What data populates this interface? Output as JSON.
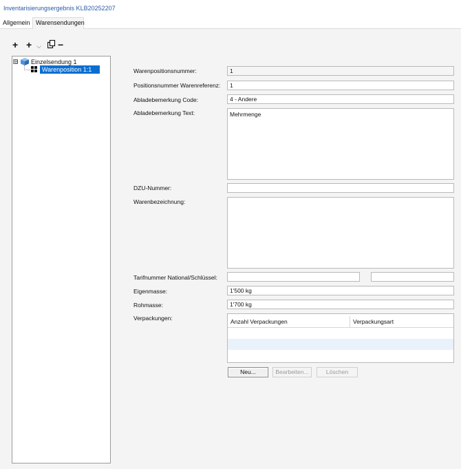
{
  "window": {
    "title": "Inventarisierungsergebnis  KLB20252207"
  },
  "tabs": [
    {
      "label": "Allgemein"
    },
    {
      "label": "Warensendungen",
      "active": true
    }
  ],
  "toolbar": {
    "add_icon": "plus-icon",
    "add_child_icon": "plus-icon",
    "dropdown_icon": "chevron-down-icon",
    "copy_icon": "copy-icon",
    "remove_icon": "minus-icon"
  },
  "tree": {
    "root": {
      "label": "Einzelsendung 1",
      "expander": "⊟",
      "icon": "cube-icon"
    },
    "child": {
      "label": "Warenposition 1:1",
      "icon": "grid-icon",
      "selected": true
    }
  },
  "form": {
    "warenpositionsnummer": {
      "label": "Warenpositionsnummer:",
      "value": "1"
    },
    "positionsnummer_warenreferenz": {
      "label": "Positionsnummer Warenreferenz:",
      "value": "1"
    },
    "abladebemerkung_code": {
      "label": "Abladebemerkung Code:",
      "value": "4 - Andere"
    },
    "abladebemerkung_text": {
      "label": "Abladebemerkung Text:",
      "value": "Mehrmenge"
    },
    "dzu_nummer": {
      "label": "DZU-Nummer:",
      "value": ""
    },
    "warenbezeichnung": {
      "label": "Warenbezeichnung:",
      "value": ""
    },
    "tarifnummer": {
      "label": "Tarifnummer National/Schlüssel:",
      "value_national": "",
      "value_schluessel": ""
    },
    "eigenmasse": {
      "label": "Eigenmasse:",
      "value": "1'500 kg"
    },
    "rohmasse": {
      "label": "Rohmasse:",
      "value": "1'700 kg"
    },
    "verpackungen": {
      "label": "Verpackungen:"
    }
  },
  "packaging_table": {
    "columns": [
      "Anzahl Verpackungen",
      "Verpackungsart"
    ],
    "rows": []
  },
  "buttons": {
    "new": "Neu...",
    "edit": "Bearbeiten...",
    "delete": "Löschen"
  },
  "colors": {
    "title": "#2a5aa8",
    "selection": "#0a6ed1",
    "row_alt": "#e9f1fb",
    "cube": "#4a90d9"
  }
}
